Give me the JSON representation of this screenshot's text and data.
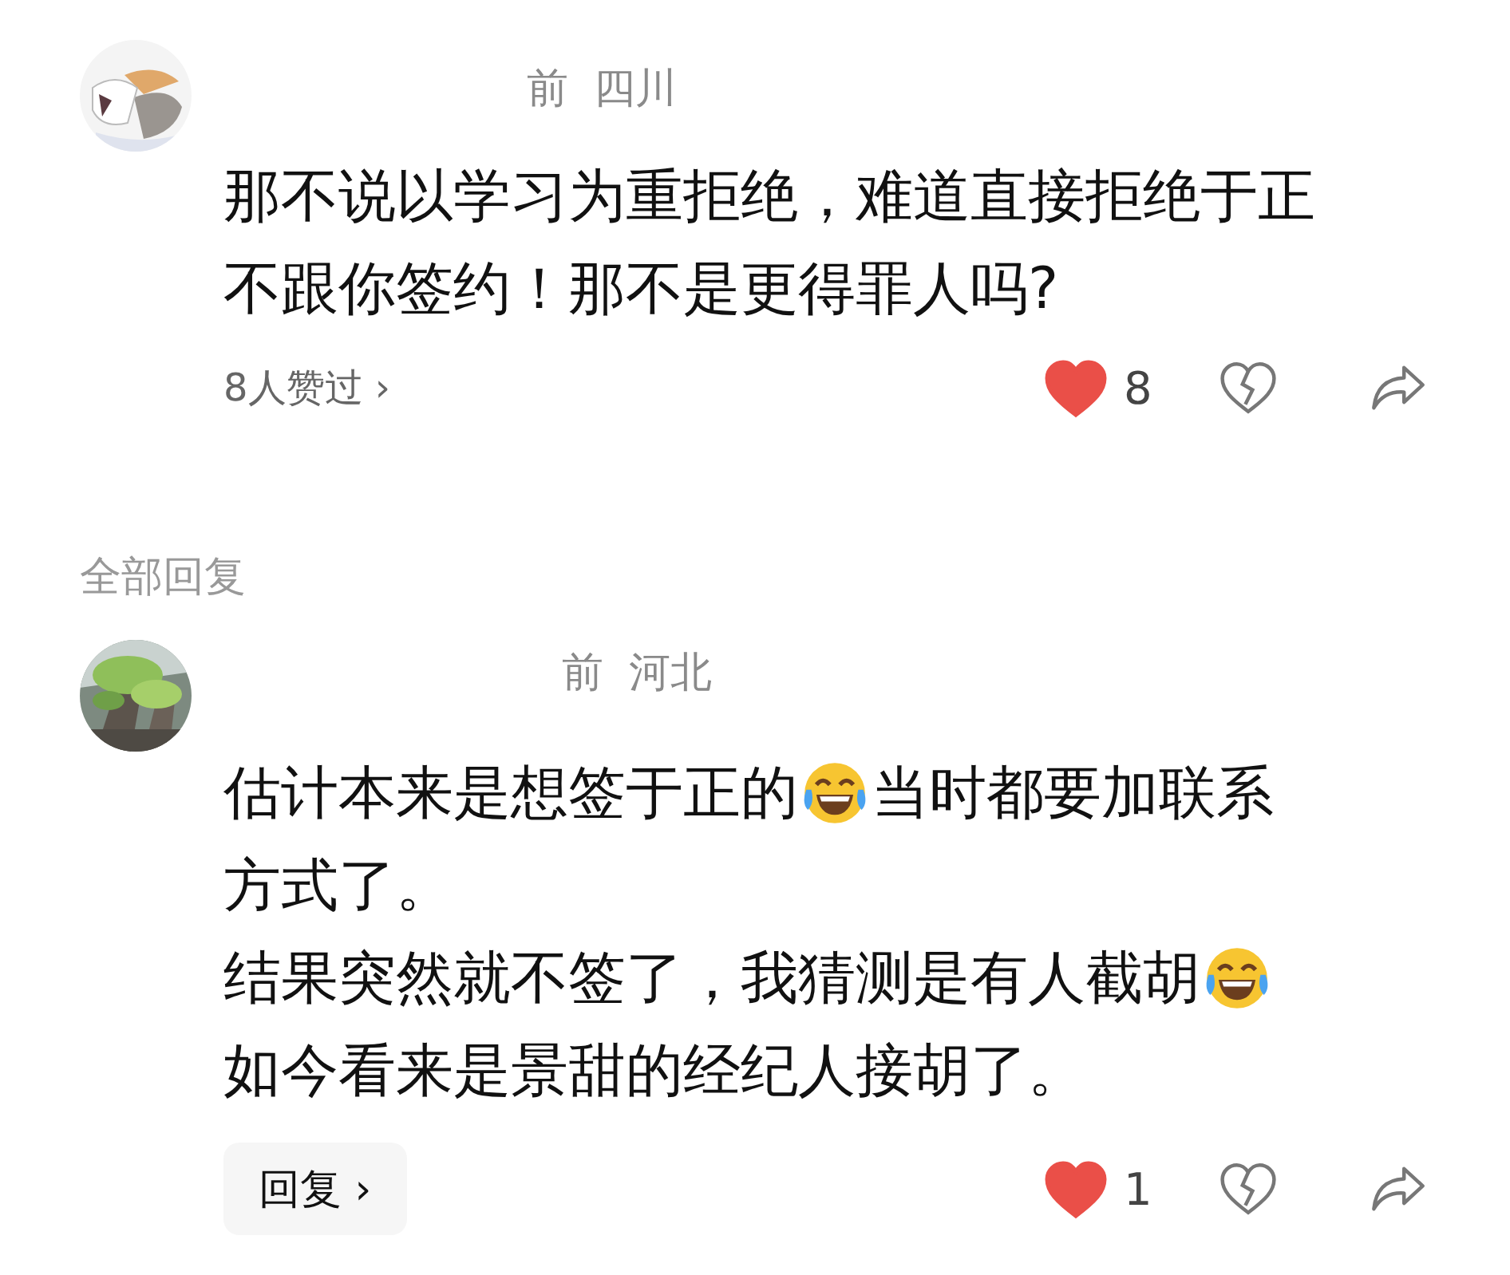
{
  "comment": {
    "avatar": {
      "kind": "picture"
    },
    "time": "前",
    "location": "四川",
    "lines": [
      [
        {
          "kind": "text",
          "text": "那不说以学习为重拒绝，难道直接拒绝于正"
        }
      ],
      [
        {
          "kind": "text",
          "text": "不跟你签约！那不是更得罪人吗?"
        }
      ]
    ],
    "likers": "8人赞过 ›",
    "liked": true,
    "likes": "8",
    "disliked": false
  },
  "replies_label": "全部回复",
  "replies": [
    {
      "avatar": {
        "kind": "picture"
      },
      "time": "前",
      "location": "河北",
      "lines": [
        [
          {
            "kind": "text",
            "text": "估计本来是想签于正的"
          },
          {
            "kind": "emoji"
          },
          {
            "kind": "text",
            "text": "当时都要加联系"
          }
        ],
        [
          {
            "kind": "text",
            "text": "方式了。"
          }
        ],
        [
          {
            "kind": "text",
            "text": "结果突然就不签了，我猜测是有人截胡"
          },
          {
            "kind": "emoji"
          }
        ],
        [
          {
            "kind": "text",
            "text": "如今看来是景甜的经纪人接胡了。"
          }
        ]
      ],
      "reply_button": "回复 ›",
      "liked": true,
      "likes": "1",
      "disliked": false
    }
  ]
}
